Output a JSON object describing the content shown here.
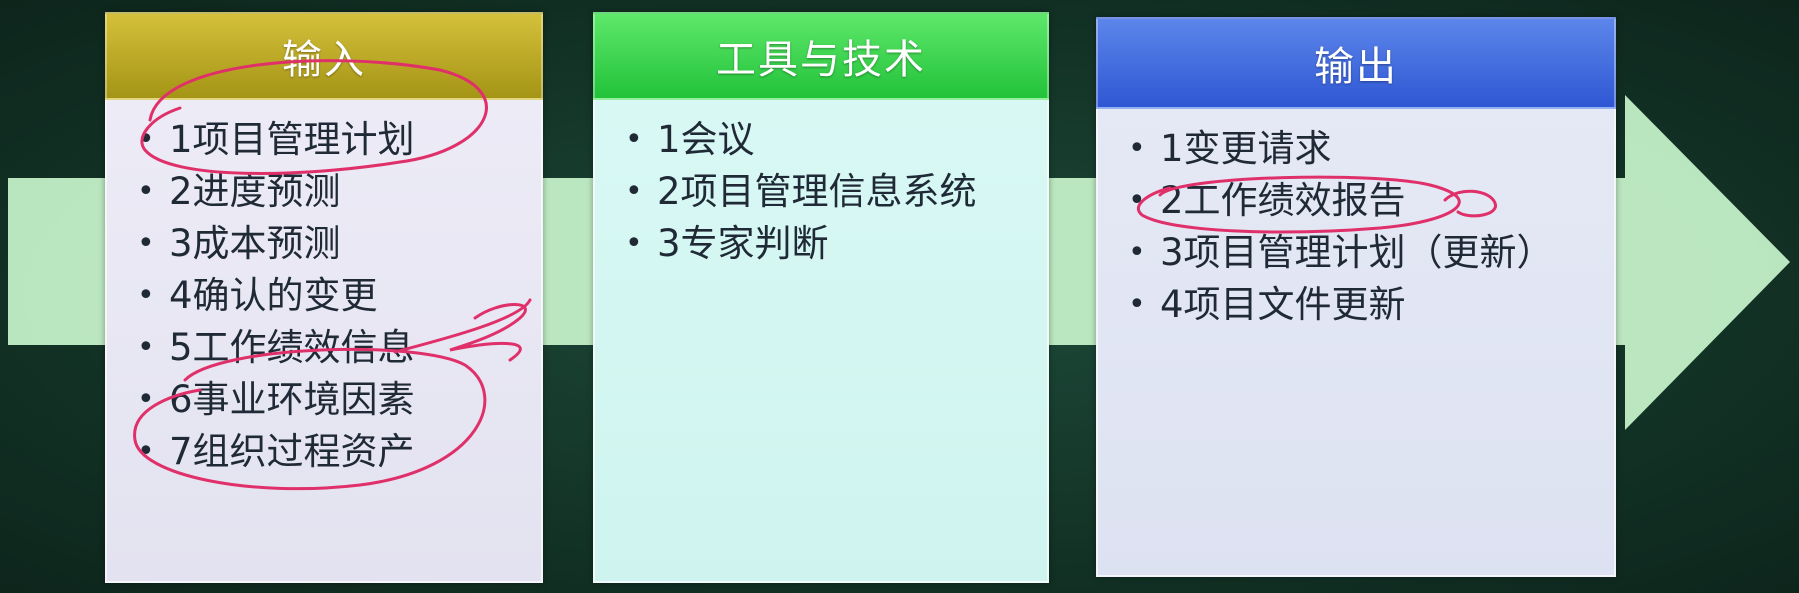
{
  "panels": {
    "input": {
      "title": "输入",
      "items": [
        "1项目管理计划",
        "2进度预测",
        "3成本预测",
        "4确认的变更",
        "5工作绩效信息",
        "6事业环境因素",
        "7组织过程资产"
      ]
    },
    "tools": {
      "title": "工具与技术",
      "items": [
        "1会议",
        "2项目管理信息系统",
        "3专家判断"
      ]
    },
    "output": {
      "title": "输出",
      "items": [
        "1变更请求",
        "2工作绩效报告",
        "3项目管理计划（更新）",
        "4项目文件更新"
      ]
    }
  },
  "bullet": "•",
  "colors": {
    "input_header": "#b8a620",
    "tools_header": "#3ad24e",
    "output_header": "#3f67dc",
    "flow_arrow": "#c4f0c8",
    "annotation": "#e0306a"
  }
}
